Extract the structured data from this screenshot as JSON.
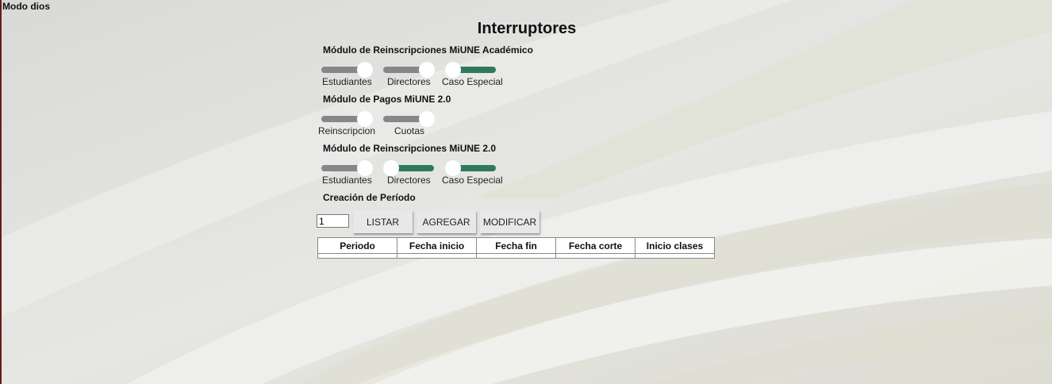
{
  "app": {
    "title": "Modo dios"
  },
  "page": {
    "title": "Interruptores"
  },
  "sections": {
    "academico": {
      "title": "Módulo de Reinscripciones MiUNE Académico",
      "switches": [
        {
          "label": "Estudiantes",
          "on": false
        },
        {
          "label": "Directores",
          "on": false
        },
        {
          "label": "Caso Especial",
          "on": true
        }
      ]
    },
    "pagos": {
      "title": "Módulo de Pagos MiUNE 2.0",
      "switches": [
        {
          "label": "Reinscripcion",
          "on": false
        },
        {
          "label": "Cuotas",
          "on": false
        }
      ]
    },
    "reinscripciones2": {
      "title": "Módulo de Reinscripciones MiUNE 2.0",
      "switches": [
        {
          "label": "Estudiantes",
          "on": false
        },
        {
          "label": "Directores",
          "on": true
        },
        {
          "label": "Caso Especial",
          "on": true
        }
      ]
    },
    "periodo": {
      "title": "Creación de Período",
      "input_value": "1",
      "buttons": {
        "listar": "LISTAR",
        "agregar": "AGREGAR",
        "modificar": "MODIFICAR"
      },
      "table": {
        "headers": [
          "Periodo",
          "Fecha inicio",
          "Fecha fin",
          "Fecha corte",
          "Inicio clases"
        ],
        "rows": []
      }
    }
  },
  "colors": {
    "switch_on": "#2f7a5a",
    "switch_off": "#878787",
    "left_border": "#6b1a1a"
  }
}
